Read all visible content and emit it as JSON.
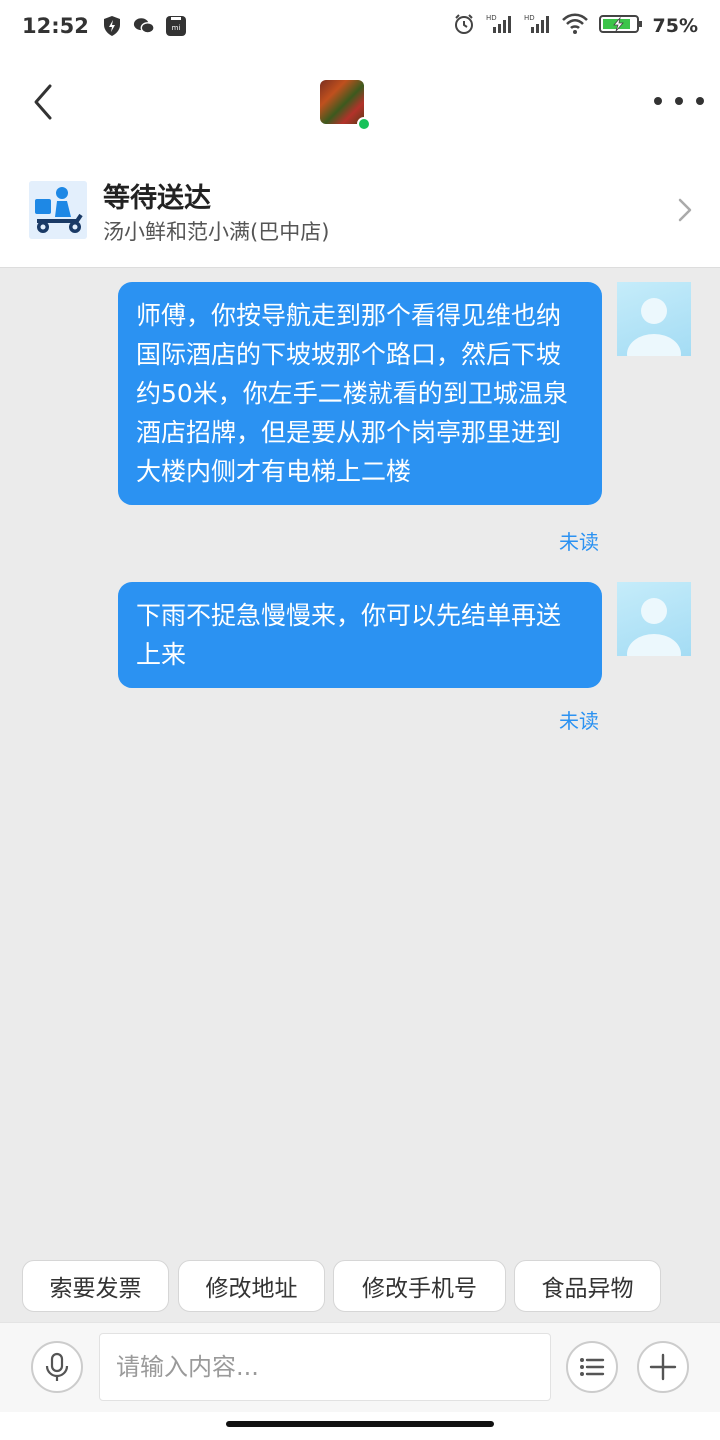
{
  "status_bar": {
    "time": "12:52",
    "icons": [
      "shield-bolt-icon",
      "wechat-icon",
      "mi-icon"
    ],
    "right_icons": [
      "alarm-icon",
      "signal-hd-icon",
      "signal-hd-icon",
      "wifi-icon",
      "battery-icon"
    ],
    "battery_percent": "75%"
  },
  "header": {
    "back_icon": "chevron-left-icon",
    "more_icon": "more-dots-icon",
    "online_color": "#18c25a"
  },
  "order": {
    "status": "等待送达",
    "shop": "汤小鲜和范小满(巴中店)"
  },
  "messages": [
    {
      "text": "师傅，你按导航走到那个看得见维也纳国际酒店的下坡坡那个路口，然后下坡约50米，你左手二楼就看的到卫城温泉酒店招牌，但是要从那个岗亭那里进到大楼内侧才有电梯上二楼",
      "status": "未读"
    },
    {
      "text": "下雨不捉急慢慢来，你可以先结单再送上来",
      "status": "未读"
    }
  ],
  "quick_replies": [
    "索要发票",
    "修改地址",
    "修改手机号",
    "食品异物"
  ],
  "input": {
    "placeholder": "请输入内容..."
  },
  "colors": {
    "accent": "#2b92f2",
    "background": "#ebebeb"
  }
}
